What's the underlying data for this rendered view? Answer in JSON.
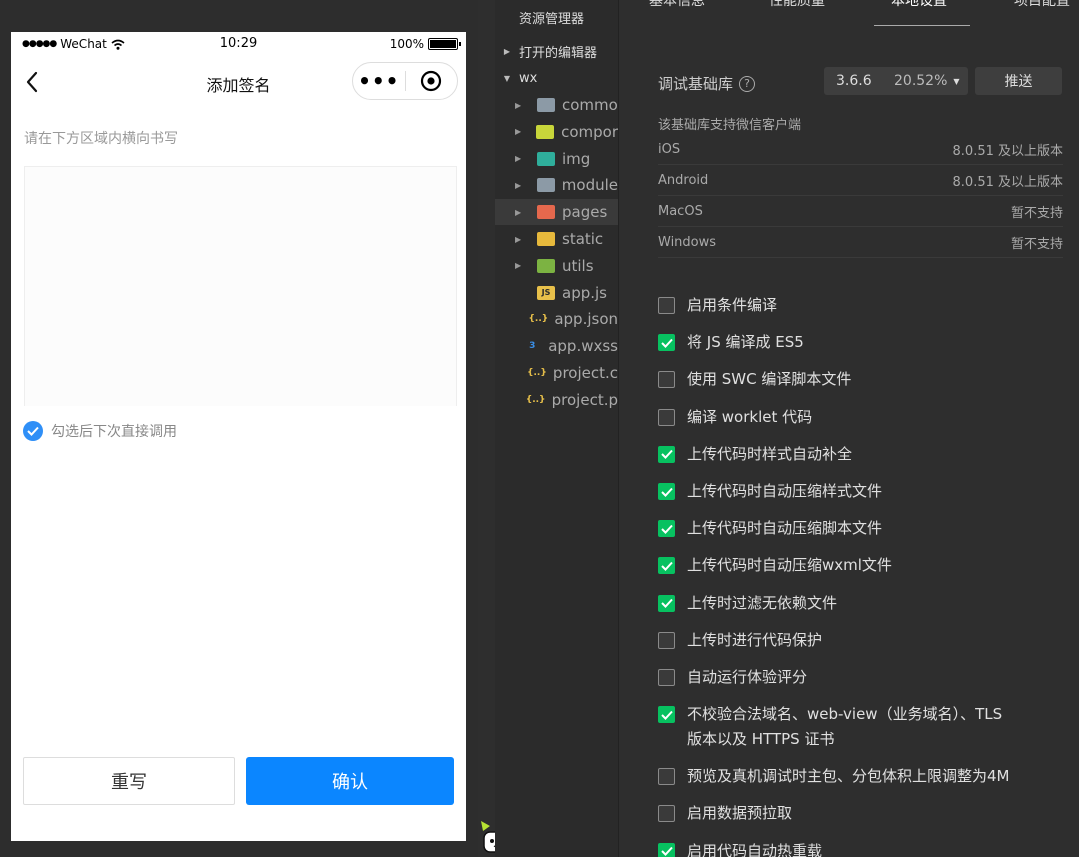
{
  "phone": {
    "status": {
      "carrier": "WeChat",
      "time": "10:29",
      "battery": "100%"
    },
    "nav_title": "添加签名",
    "hint": "请在下方区域内横向书写",
    "remember_label": "勾选后下次直接调用",
    "remember_checked": true,
    "reset_label": "重写",
    "confirm_label": "确认",
    "accent_color": "#0b86ff"
  },
  "explorer": {
    "title": "资源管理器",
    "open_editors": "打开的编辑器",
    "root": "wx",
    "items": [
      {
        "name": "commo",
        "type": "folder",
        "icon": "folder-icon",
        "color": "#8c9aa6"
      },
      {
        "name": "compor",
        "type": "folder",
        "icon": "components-folder-icon",
        "color": "#c8d63a"
      },
      {
        "name": "img",
        "type": "folder",
        "icon": "image-folder-icon",
        "color": "#2fae9b"
      },
      {
        "name": "module",
        "type": "folder",
        "icon": "folder-icon",
        "color": "#8c9aa6"
      },
      {
        "name": "pages",
        "type": "folder",
        "icon": "pages-folder-icon",
        "color": "#e5684d",
        "selected": true
      },
      {
        "name": "static",
        "type": "folder",
        "icon": "static-folder-icon",
        "color": "#e7b93c"
      },
      {
        "name": "utils",
        "type": "folder",
        "icon": "utils-folder-icon",
        "color": "#7cb342"
      },
      {
        "name": "app.js",
        "type": "file",
        "icon": "js-file-icon",
        "color": "#e8c04a"
      },
      {
        "name": "app.json",
        "type": "file",
        "icon": "json-file-icon",
        "color": "#e8c04a"
      },
      {
        "name": "app.wxss",
        "type": "file",
        "icon": "css-file-icon",
        "color": "#3a8ee6"
      },
      {
        "name": "project.c",
        "type": "file",
        "icon": "json-file-icon",
        "color": "#e8c04a"
      },
      {
        "name": "project.p",
        "type": "file",
        "icon": "json-file-icon",
        "color": "#e8c04a"
      }
    ]
  },
  "settings": {
    "tabs": [
      "基本信息",
      "性能质量",
      "本地设置",
      "项目配置"
    ],
    "active_tab": "本地设置",
    "lib_label": "调试基础库",
    "lib_version": "3.6.6",
    "lib_percent": "20.52%",
    "push_label": "推送",
    "support_title": "该基础库支持微信客户端",
    "support": [
      {
        "platform": "iOS",
        "value": "8.0.51 及以上版本"
      },
      {
        "platform": "Android",
        "value": "8.0.51 及以上版本"
      },
      {
        "platform": "MacOS",
        "value": "暂不支持"
      },
      {
        "platform": "Windows",
        "value": "暂不支持"
      }
    ],
    "options": [
      {
        "label": "启用条件编译",
        "checked": false
      },
      {
        "label": "将 JS 编译成 ES5",
        "checked": true
      },
      {
        "label": "使用 SWC 编译脚本文件",
        "checked": false
      },
      {
        "label": "编译 worklet 代码",
        "checked": false
      },
      {
        "label": "上传代码时样式自动补全",
        "checked": true
      },
      {
        "label": "上传代码时自动压缩样式文件",
        "checked": true
      },
      {
        "label": "上传代码时自动压缩脚本文件",
        "checked": true
      },
      {
        "label": "上传代码时自动压缩wxml文件",
        "checked": true
      },
      {
        "label": "上传时过滤无依赖文件",
        "checked": true
      },
      {
        "label": "上传时进行代码保护",
        "checked": false
      },
      {
        "label": "自动运行体验评分",
        "checked": false
      },
      {
        "label": "不校验合法域名、web-view（业务域名）、TLS",
        "label2": "版本以及 HTTPS 证书",
        "checked": true
      },
      {
        "label": "预览及真机调试时主包、分包体积上限调整为4M",
        "checked": false
      },
      {
        "label": "启用数据预拉取",
        "checked": false
      },
      {
        "label": "启用代码自动热重载",
        "checked": true
      }
    ],
    "check_color": "#07c160"
  }
}
